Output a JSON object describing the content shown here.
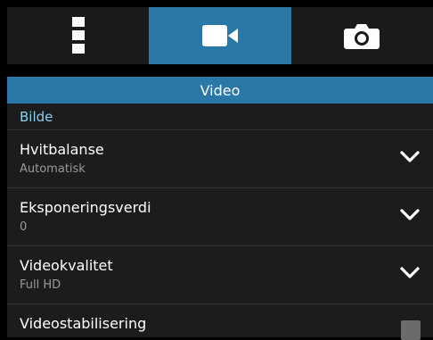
{
  "tabs": [
    {
      "icon": "settings-menu-icon"
    },
    {
      "icon": "video-camera-icon",
      "active": true
    },
    {
      "icon": "camera-icon"
    }
  ],
  "section": {
    "title": "Video"
  },
  "category": {
    "label": "Bilde"
  },
  "settings": [
    {
      "title": "Hvitbalanse",
      "value": "Automatisk",
      "control": "chevron-down-icon"
    },
    {
      "title": "Eksponeringsverdi",
      "value": "0",
      "control": "chevron-down-icon"
    },
    {
      "title": "Videokvalitet",
      "value": "Full HD",
      "control": "chevron-down-icon"
    },
    {
      "title": "Videostabilisering",
      "control": "checkbox",
      "checked": false
    }
  ],
  "colors": {
    "accent": "#2a78a8",
    "category_text": "#8ccfee",
    "background": "#1c1c1c"
  }
}
